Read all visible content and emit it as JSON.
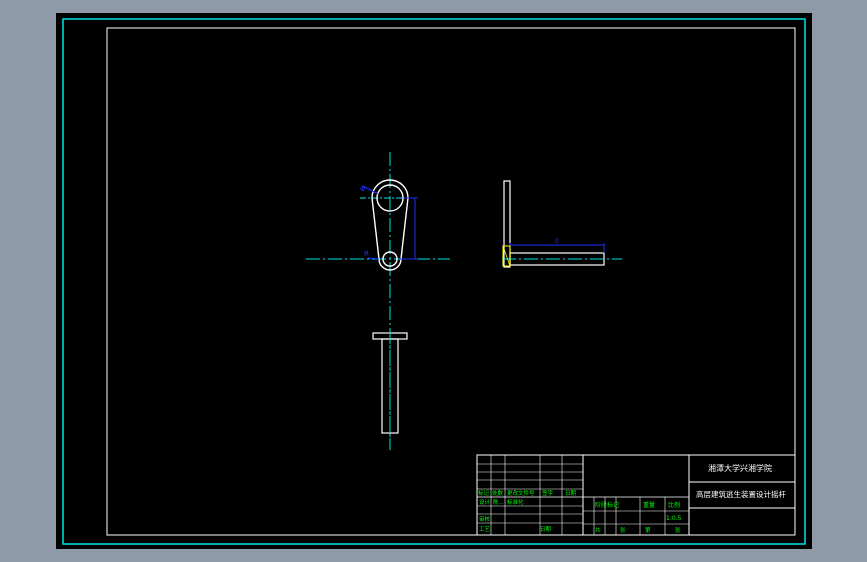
{
  "title_block": {
    "school": "湘潭大学兴湘学院",
    "drawing_title": "高层建筑逃生装置设计摇杆",
    "scale": "1:0.5",
    "r1": [
      "",
      "",
      "",
      "",
      ""
    ],
    "r2": [
      "标记",
      "处数",
      "更改文件号",
      "签字",
      "日期"
    ],
    "r3": [
      "设计",
      "陈...",
      "标准化"
    ],
    "r4": [
      "审核"
    ],
    "r5": [
      "工艺",
      "",
      "日期"
    ],
    "grid_header": [
      "阶段标记",
      "重量",
      "比例"
    ],
    "sheet_labels": [
      "共",
      "张",
      "第",
      "张"
    ]
  },
  "dims": {
    "d_top": "Φ",
    "d_bottom": "R",
    "vertical": "",
    "horizontal": "0"
  },
  "colors": {
    "frame": "#00ffff",
    "line": "#ffffff",
    "dim": "#2030ff",
    "center": "#00ffff",
    "text": "#00ff00"
  }
}
